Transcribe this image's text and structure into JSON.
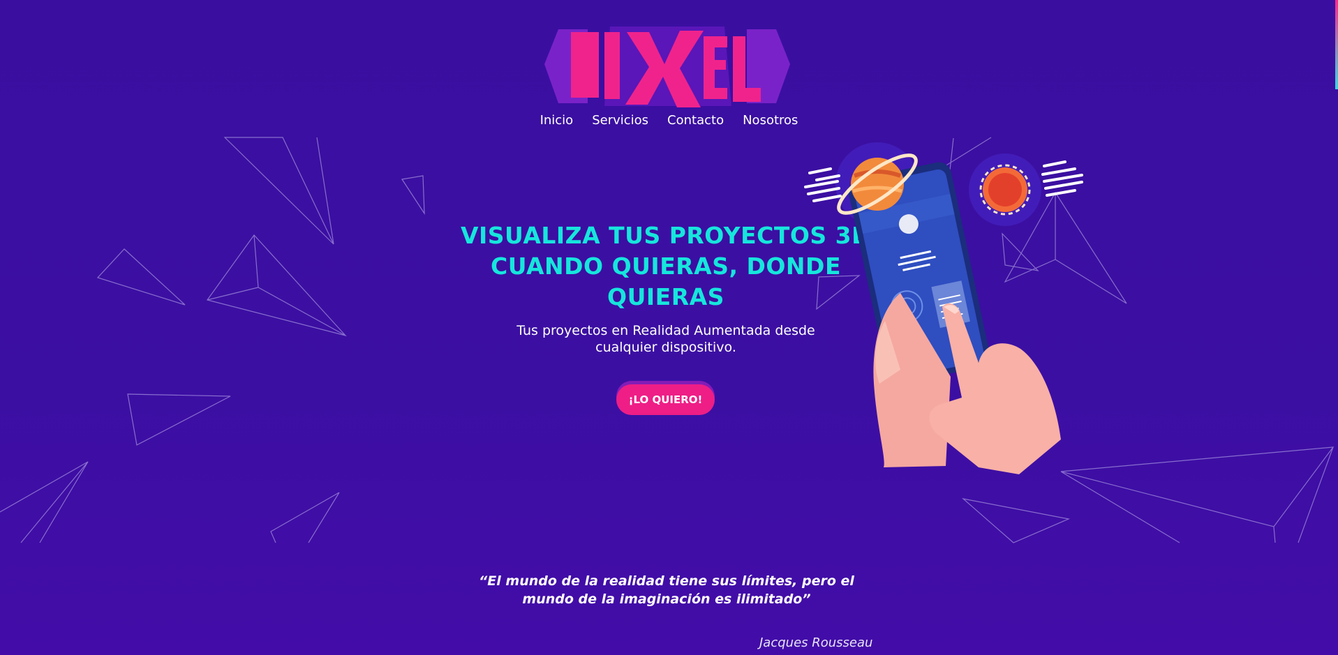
{
  "brand": {
    "logo_text": "DIXEL",
    "colors": {
      "background": "#3c0fa3",
      "accent_pink": "#ee1e86",
      "accent_cyan": "#16e6dc"
    }
  },
  "nav": {
    "items": [
      "Inicio",
      "Servicios",
      "Contacto",
      "Nosotros"
    ]
  },
  "hero": {
    "title_lines": [
      "VISUALIZA TUS PROYECTOS 3D",
      "CUANDO QUIERAS, DONDE",
      "QUIERAS"
    ],
    "subtitle_lines": [
      "Tus proyectos en Realidad Aumentada desde",
      "cualquier dispositivo."
    ],
    "cta_label": "¡LO QUIERO!"
  },
  "illustration": {
    "icon": "hand-holding-phone-with-planets-icon"
  },
  "quote": {
    "lines": [
      "“El mundo de la realidad tiene sus límites, pero el",
      "mundo de la imaginación es ilimitado”"
    ],
    "author": "Jacques Rousseau"
  }
}
